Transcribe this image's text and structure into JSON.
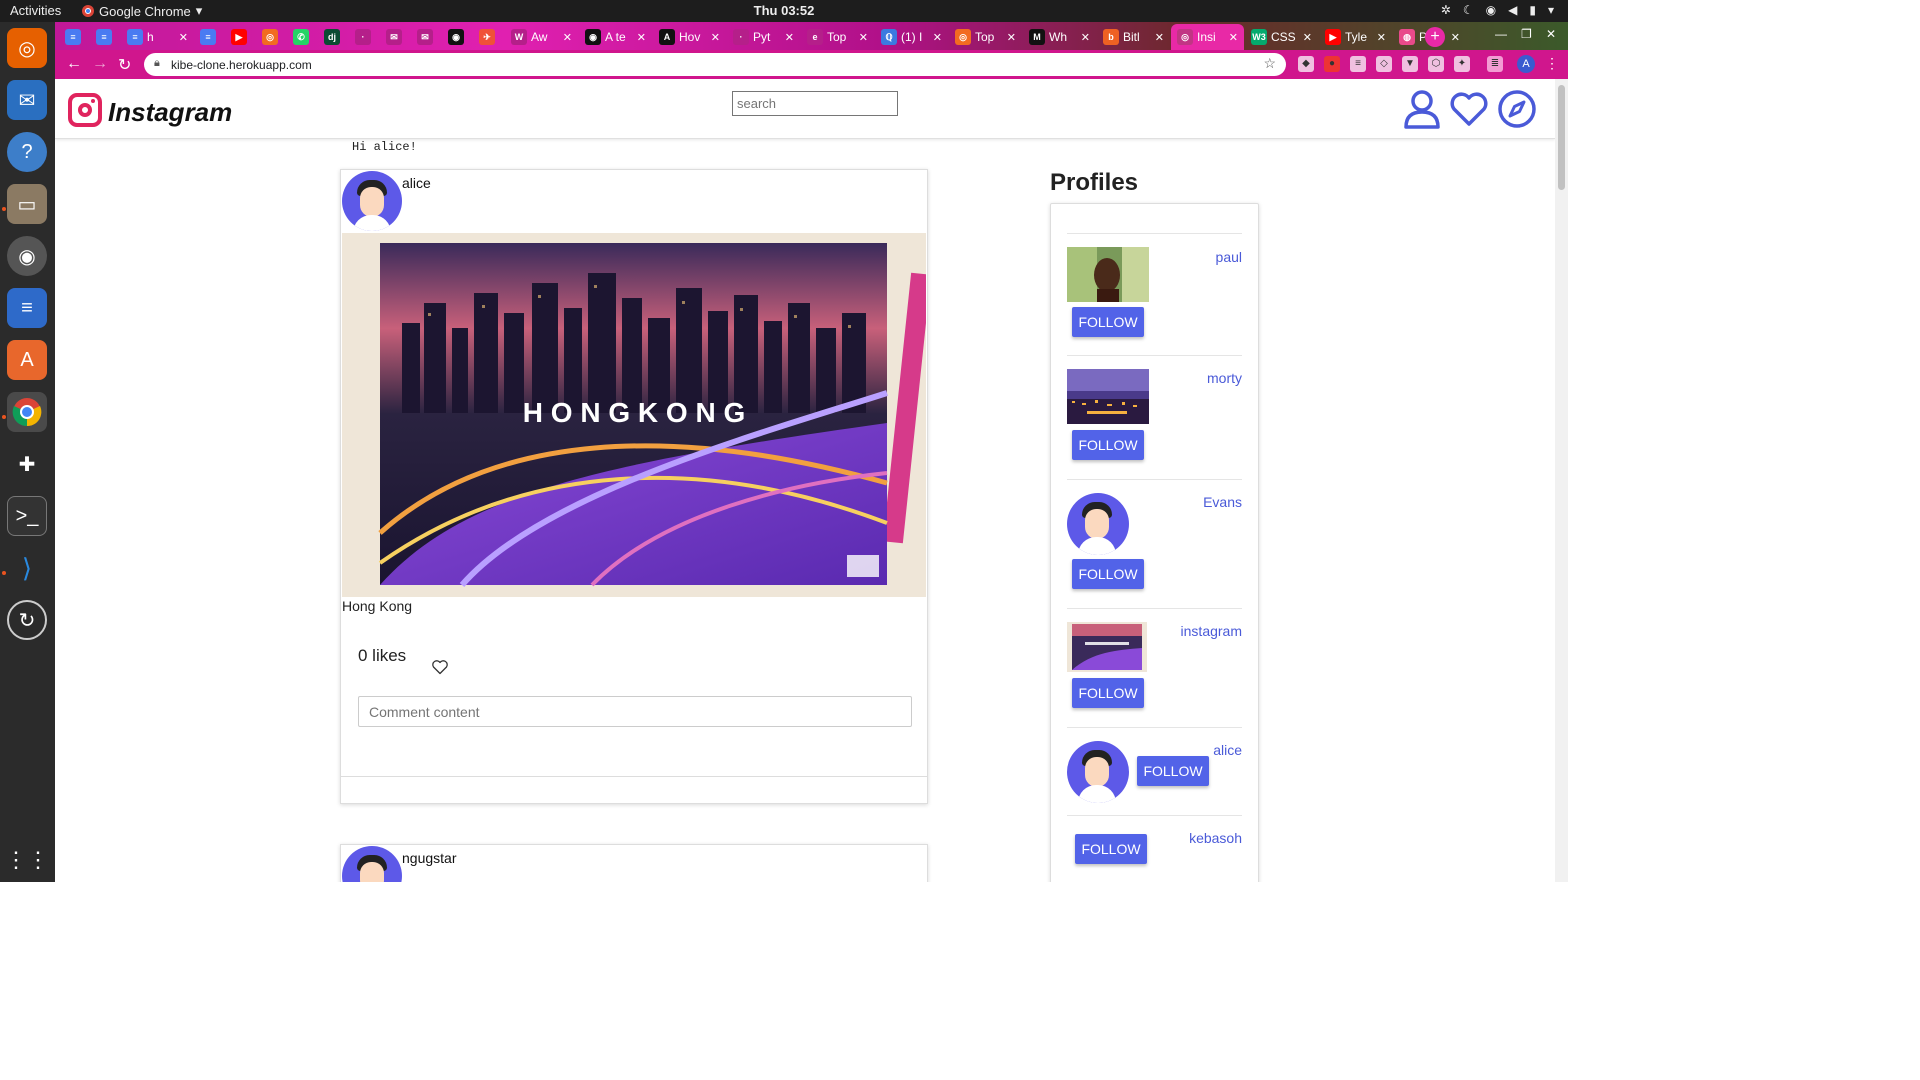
{
  "os": {
    "activities_label": "Activities",
    "app_name": "Google Chrome",
    "clock": "Thu 03:52"
  },
  "browser": {
    "tabs": [
      {
        "label": "",
        "favicon": "docs-icon"
      },
      {
        "label": "",
        "favicon": "docs-icon"
      },
      {
        "label": "h",
        "favicon": "docs-icon"
      },
      {
        "label": "",
        "favicon": "docs-icon"
      },
      {
        "label": "",
        "favicon": "youtube-icon"
      },
      {
        "label": "",
        "favicon": "orange-icon"
      },
      {
        "label": "",
        "favicon": "whatsapp-icon"
      },
      {
        "label": "",
        "favicon": "django-icon"
      },
      {
        "label": "",
        "favicon": "generic-icon"
      },
      {
        "label": "",
        "favicon": "gmail-icon"
      },
      {
        "label": "",
        "favicon": "gmail-icon"
      },
      {
        "label": "",
        "favicon": "github-icon"
      },
      {
        "label": "",
        "favicon": "swift-icon"
      },
      {
        "label": "Aw",
        "favicon": "w-icon"
      },
      {
        "label": "A te",
        "favicon": "github-icon"
      },
      {
        "label": "Hov",
        "favicon": "a-icon"
      },
      {
        "label": "Pyt",
        "favicon": "generic-icon"
      },
      {
        "label": "Top",
        "favicon": "e-icon"
      },
      {
        "label": "(1) I",
        "favicon": "q-icon"
      },
      {
        "label": "Top",
        "favicon": "orange-icon"
      },
      {
        "label": "Wh",
        "favicon": "medium-icon"
      },
      {
        "label": "Bitl",
        "favicon": "bitly-icon"
      },
      {
        "label": "Insi",
        "favicon": "instagram-icon"
      },
      {
        "label": "CSS",
        "favicon": "w3-icon"
      },
      {
        "label": "Tyle",
        "favicon": "youtube-icon"
      },
      {
        "label": "Pro",
        "favicon": "globe-icon"
      }
    ],
    "active_tab_index": 22,
    "url": "kibe-clone.herokuapp.com",
    "profile_initial": "A"
  },
  "site": {
    "brand": "Instagram",
    "search_placeholder": "search",
    "greeting": "Hi alice!"
  },
  "posts": [
    {
      "username": "alice",
      "image_text": "H O N G   K O N G",
      "caption": "Hong Kong",
      "likes_label": "0 likes",
      "comment_placeholder": "Comment content"
    },
    {
      "username": "ngugstar"
    }
  ],
  "profiles": {
    "title": "Profiles",
    "follow_label": "FOLLOW",
    "items": [
      {
        "name": "paul",
        "thumb": "portrait-photo"
      },
      {
        "name": "morty",
        "thumb": "night-city-photo"
      },
      {
        "name": "Evans",
        "thumb": "default-avatar"
      },
      {
        "name": "instagram",
        "thumb": "hong-kong-photo"
      },
      {
        "name": "alice",
        "thumb": "default-avatar"
      },
      {
        "name": "kebasoh",
        "thumb": "none"
      }
    ]
  },
  "colors": {
    "accent": "#5263e8",
    "link": "#4a5ad8",
    "brand_pink": "#e0245e",
    "chrome_theme": "#d0168d"
  }
}
